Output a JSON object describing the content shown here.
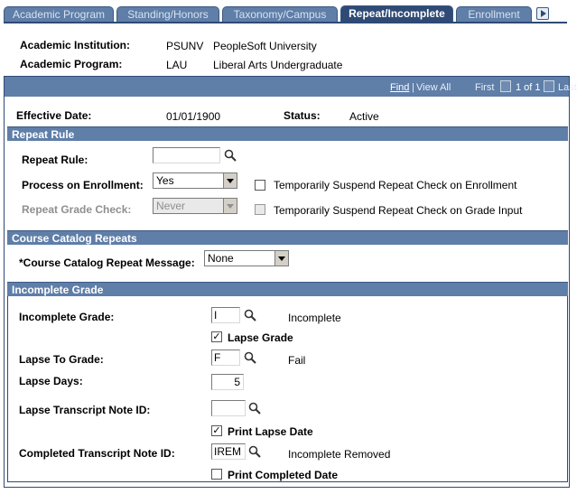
{
  "tabs": [
    {
      "label": "Academic Program"
    },
    {
      "label": "Standing/Honors"
    },
    {
      "label": "Taxonomy/Campus"
    },
    {
      "label": "Repeat/Incomplete"
    },
    {
      "label": "Enrollment"
    }
  ],
  "header": {
    "institution_label": "Academic Institution:",
    "institution_code": "PSUNV",
    "institution_name": "PeopleSoft University",
    "program_label": "Academic Program:",
    "program_code": "LAU",
    "program_name": "Liberal Arts Undergraduate"
  },
  "scroll_nav": {
    "find": "Find",
    "view_all": "View All",
    "first": "First",
    "counter": "1 of 1",
    "last": "Last"
  },
  "effective": {
    "date_label": "Effective Date:",
    "date_value": "01/01/1900",
    "status_label": "Status:",
    "status_value": "Active"
  },
  "repeat_rule": {
    "title": "Repeat Rule",
    "rule_label": "Repeat Rule:",
    "rule_value": "",
    "process_label": "Process on Enrollment:",
    "process_value": "Yes",
    "suspend_enroll_label": "Temporarily Suspend Repeat Check on Enrollment",
    "suspend_enroll_checked": false,
    "grade_check_label": "Repeat Grade Check:",
    "grade_check_value": "Never",
    "suspend_grade_label": "Temporarily Suspend Repeat Check on Grade Input",
    "suspend_grade_checked": false
  },
  "catalog": {
    "title": "Course Catalog Repeats",
    "message_label": "*Course Catalog Repeat Message:",
    "message_value": "None"
  },
  "incomplete": {
    "title": "Incomplete Grade",
    "grade_label": "Incomplete Grade:",
    "grade_value": "I",
    "grade_desc": "Incomplete",
    "lapse_grade_label": "Lapse Grade",
    "lapse_grade_checked": true,
    "lapse_to_label": "Lapse To Grade:",
    "lapse_to_value": "F",
    "lapse_to_desc": "Fail",
    "lapse_days_label": "Lapse Days:",
    "lapse_days_value": "5",
    "lapse_note_label": "Lapse Transcript Note ID:",
    "lapse_note_value": "",
    "print_lapse_label": "Print Lapse Date",
    "print_lapse_checked": true,
    "completed_note_label": "Completed Transcript Note ID:",
    "completed_note_value": "IREM",
    "completed_note_desc": "Incomplete Removed",
    "print_completed_label": "Print Completed Date",
    "print_completed_checked": false
  },
  "colors": {
    "tab": "#5f7ea8",
    "tab_active": "#2e4a75",
    "section_bar": "#5f7ea8"
  }
}
